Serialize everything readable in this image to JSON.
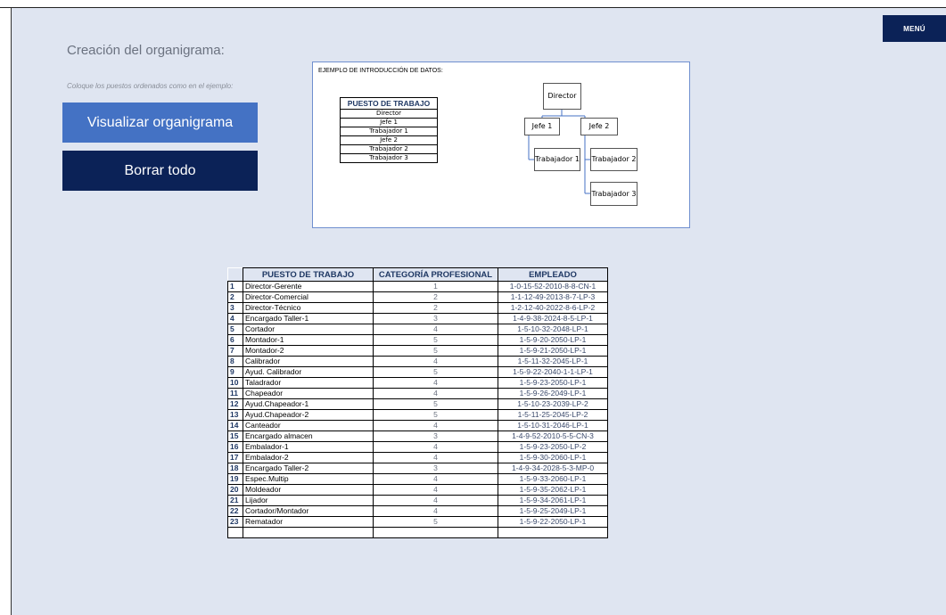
{
  "menu": {
    "label": "MENÚ"
  },
  "page": {
    "title": "Creación del organigrama:",
    "subtitle": "Coloque los puestos ordenados como en el ejemplo:"
  },
  "buttons": {
    "visualizar": "Visualizar organigrama",
    "borrar": "Borrar todo"
  },
  "example": {
    "title": "EJEMPLO DE INTRODUCCIÓN DE DATOS:",
    "table_header": "PUESTO DE TRABAJO",
    "rows": [
      "Director",
      "Jefe 1",
      "Trabajador 1",
      "Jefe 2",
      "Trabajador 2",
      "Trabajador 3"
    ],
    "chart": {
      "director": "Director",
      "jefe1": "Jefe 1",
      "jefe2": "Jefe 2",
      "trab1": "Trabajador 1",
      "trab2": "Trabajador 2",
      "trab3": "Trabajador 3"
    }
  },
  "table": {
    "headers": {
      "puesto": "PUESTO DE TRABAJO",
      "categoria": "CATEGORÍA PROFESIONAL",
      "empleado": "EMPLEADO"
    },
    "rows": [
      {
        "n": "1",
        "puesto": "Director-Gerente",
        "cat": "1",
        "emp": "1-0-15-52-2010-8-8-CN-1"
      },
      {
        "n": "2",
        "puesto": "Director-Comercial",
        "cat": "2",
        "emp": "1-1-12-49-2013-8-7-LP-3"
      },
      {
        "n": "3",
        "puesto": "Director-Técnico",
        "cat": "2",
        "emp": "1-2-12-40-2022-8-6-LP-2"
      },
      {
        "n": "4",
        "puesto": "Encargado Taller-1",
        "cat": "3",
        "emp": "1-4-9-38-2024-8-5-LP-1"
      },
      {
        "n": "5",
        "puesto": "Cortador",
        "cat": "4",
        "emp": "1-5-10-32-2048-LP-1"
      },
      {
        "n": "6",
        "puesto": "Montador-1",
        "cat": "5",
        "emp": "1-5-9-20-2050-LP-1"
      },
      {
        "n": "7",
        "puesto": "Montador-2",
        "cat": "5",
        "emp": "1-5-9-21-2050-LP-1"
      },
      {
        "n": "8",
        "puesto": "Calibrador",
        "cat": "4",
        "emp": "1-5-11-32-2045-LP-1"
      },
      {
        "n": "9",
        "puesto": "Ayud. Calibrador",
        "cat": "5",
        "emp": "1-5-9-22-2040-1-1-LP-1"
      },
      {
        "n": "10",
        "puesto": "Taladrador",
        "cat": "4",
        "emp": "1-5-9-23-2050-LP-1"
      },
      {
        "n": "11",
        "puesto": "Chapeador",
        "cat": "4",
        "emp": "1-5-9-26-2049-LP-1"
      },
      {
        "n": "12",
        "puesto": "Ayud.Chapeador-1",
        "cat": "5",
        "emp": "1-5-10-23-2039-LP-2"
      },
      {
        "n": "13",
        "puesto": "Ayud.Chapeador-2",
        "cat": "5",
        "emp": "1-5-11-25-2045-LP-2"
      },
      {
        "n": "14",
        "puesto": "Canteador",
        "cat": "4",
        "emp": "1-5-10-31-2046-LP-1"
      },
      {
        "n": "15",
        "puesto": "Encargado almacen",
        "cat": "3",
        "emp": "1-4-9-52-2010-5-5-CN-3"
      },
      {
        "n": "16",
        "puesto": "Embalador-1",
        "cat": "4",
        "emp": "1-5-9-23-2050-LP-2"
      },
      {
        "n": "17",
        "puesto": "Embalador-2",
        "cat": "4",
        "emp": "1-5-9-30-2060-LP-1"
      },
      {
        "n": "18",
        "puesto": "Encargado Taller-2",
        "cat": "3",
        "emp": "1-4-9-34-2028-5-3-MP-0"
      },
      {
        "n": "19",
        "puesto": "Espec.Multip",
        "cat": "4",
        "emp": "1-5-9-33-2060-LP-1"
      },
      {
        "n": "20",
        "puesto": "Moldeador",
        "cat": "4",
        "emp": "1-5-9-35-2062-LP-1"
      },
      {
        "n": "21",
        "puesto": "Lijador",
        "cat": "4",
        "emp": "1-5-9-34-2061-LP-1"
      },
      {
        "n": "22",
        "puesto": "Cortador/Montador",
        "cat": "4",
        "emp": "1-5-9-25-2049-LP-1"
      },
      {
        "n": "23",
        "puesto": "Rematador",
        "cat": "5",
        "emp": "1-5-9-22-2050-LP-1"
      },
      {
        "n": "",
        "puesto": "",
        "cat": "",
        "emp": ""
      }
    ]
  }
}
